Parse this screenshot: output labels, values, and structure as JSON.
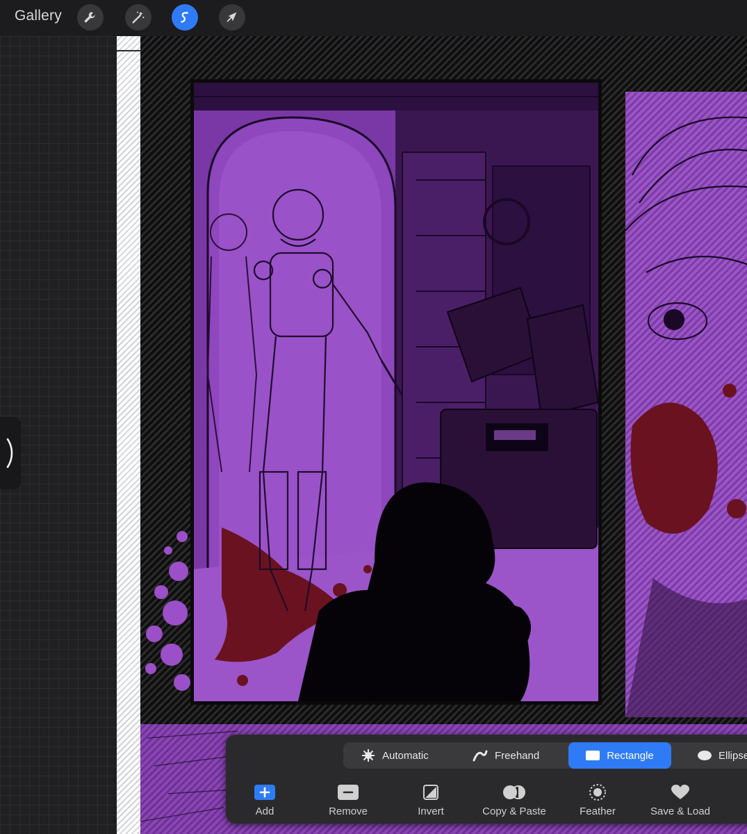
{
  "topbar": {
    "gallery_label": "Gallery",
    "tools": [
      {
        "name": "actions",
        "icon": "wrench-icon"
      },
      {
        "name": "adjustments",
        "icon": "magic-wand-icon"
      },
      {
        "name": "selection",
        "icon": "selection-s-icon",
        "active": true
      },
      {
        "name": "transform",
        "icon": "arrow-cursor-icon"
      }
    ]
  },
  "sidebar": {
    "toggle_icon": "chevron-right-icon"
  },
  "selection_toolbar": {
    "modes": [
      {
        "label": "Automatic",
        "icon": "starburst-icon"
      },
      {
        "label": "Freehand",
        "icon": "freehand-stroke-icon"
      },
      {
        "label": "Rectangle",
        "icon": "rectangle-icon",
        "active": true
      },
      {
        "label": "Ellipse",
        "icon": "ellipse-icon"
      }
    ],
    "actions": [
      {
        "label": "Add",
        "icon": "plus-icon"
      },
      {
        "label": "Remove",
        "icon": "minus-icon"
      },
      {
        "label": "Invert",
        "icon": "invert-icon"
      },
      {
        "label": "Copy & Paste",
        "icon": "copy-paste-icon"
      },
      {
        "label": "Feather",
        "icon": "feather-icon"
      },
      {
        "label": "Save & Load",
        "icon": "heart-icon"
      }
    ]
  },
  "colors": {
    "accent": "#2f7bf6",
    "toolbar_bg": "#2a2a2c",
    "canvas_purple": "#7b3aa8"
  }
}
